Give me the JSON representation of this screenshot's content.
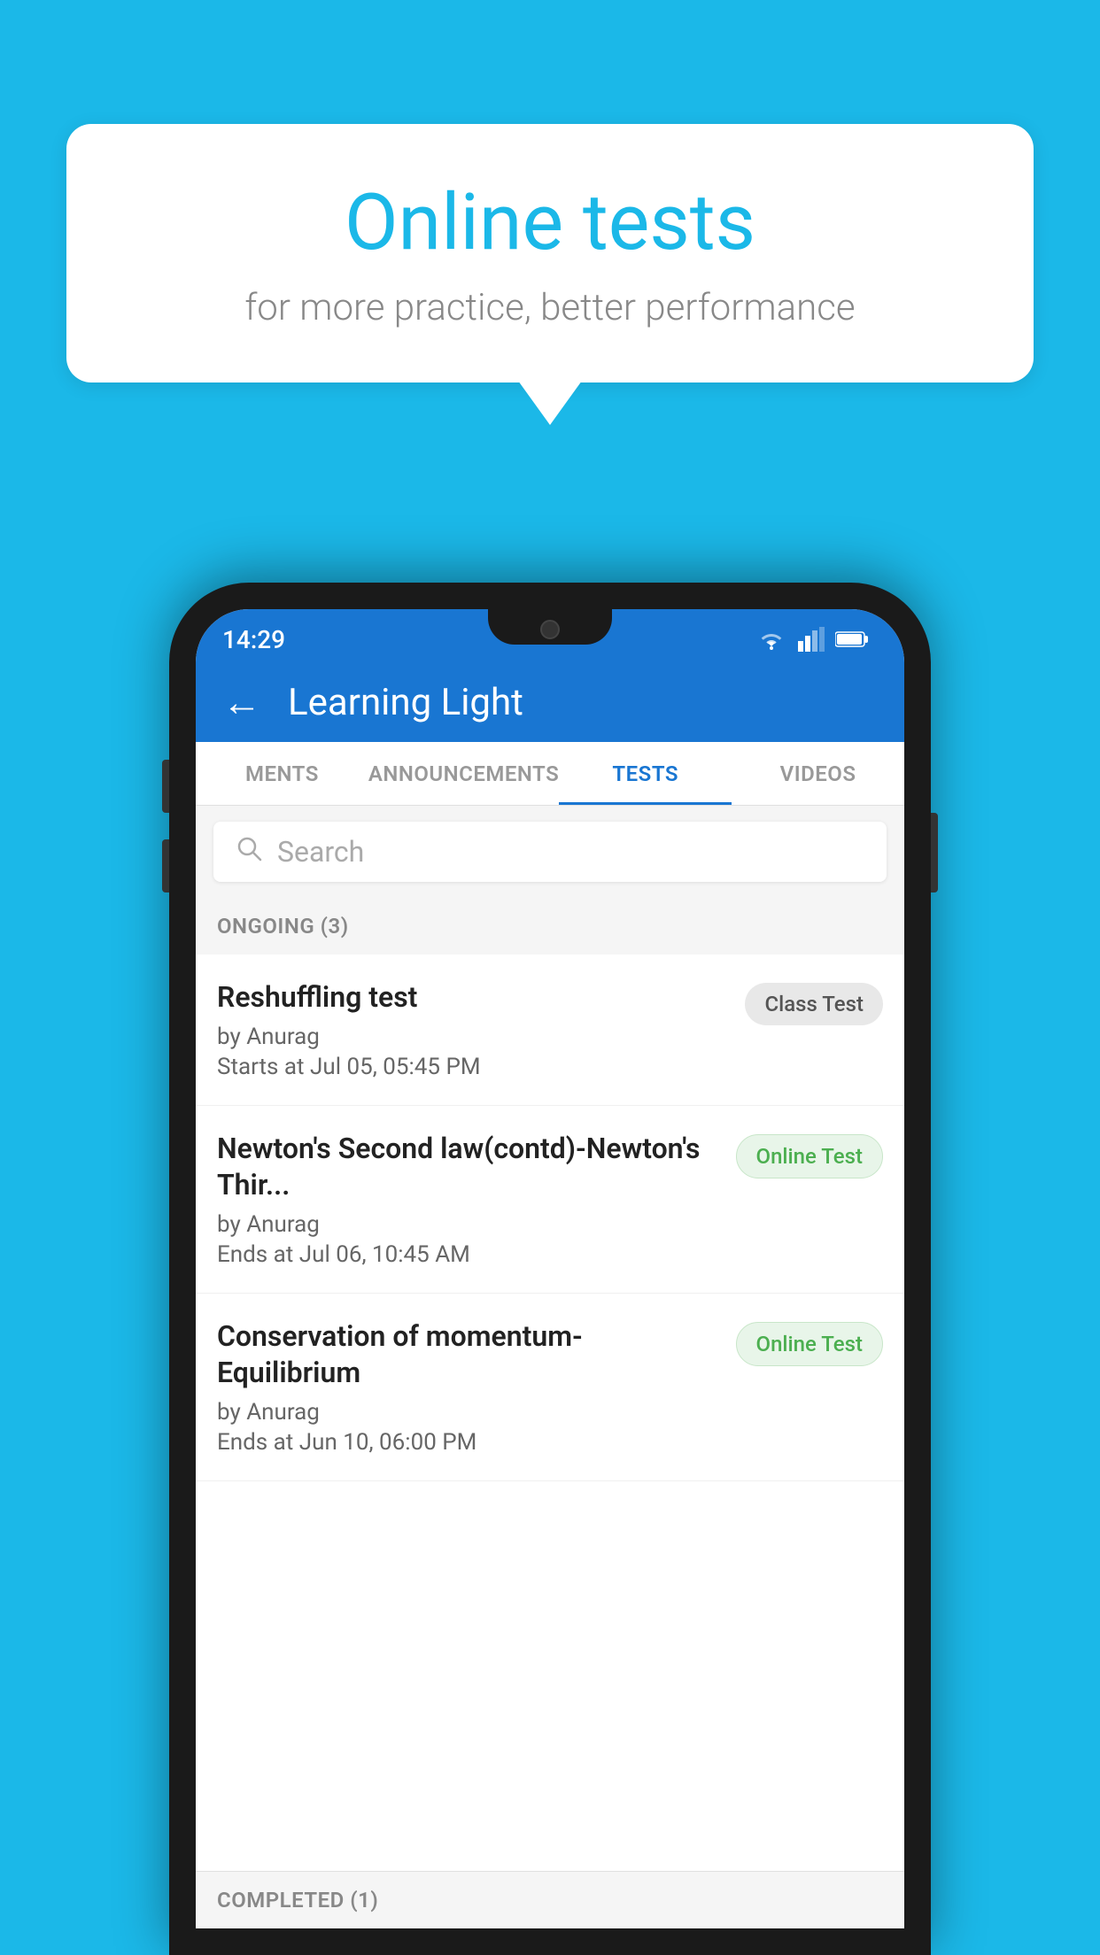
{
  "background_color": "#1BB8E8",
  "speech_bubble": {
    "title": "Online tests",
    "subtitle": "for more practice, better performance"
  },
  "phone": {
    "status_bar": {
      "time": "14:29"
    },
    "header": {
      "title": "Learning Light",
      "back_label": "←"
    },
    "tabs": [
      {
        "label": "MENTS",
        "active": false
      },
      {
        "label": "ANNOUNCEMENTS",
        "active": false
      },
      {
        "label": "TESTS",
        "active": true
      },
      {
        "label": "VIDEOS",
        "active": false
      }
    ],
    "search": {
      "placeholder": "Search"
    },
    "ongoing_section": {
      "label": "ONGOING (3)"
    },
    "tests": [
      {
        "name": "Reshuffling test",
        "author": "by Anurag",
        "time_label": "Starts at",
        "time": "Jul 05, 05:45 PM",
        "badge": "Class Test",
        "badge_type": "class"
      },
      {
        "name": "Newton's Second law(contd)-Newton's Thir...",
        "author": "by Anurag",
        "time_label": "Ends at",
        "time": "Jul 06, 10:45 AM",
        "badge": "Online Test",
        "badge_type": "online"
      },
      {
        "name": "Conservation of momentum-Equilibrium",
        "author": "by Anurag",
        "time_label": "Ends at",
        "time": "Jun 10, 06:00 PM",
        "badge": "Online Test",
        "badge_type": "online"
      }
    ],
    "completed_section": {
      "label": "COMPLETED (1)"
    }
  }
}
